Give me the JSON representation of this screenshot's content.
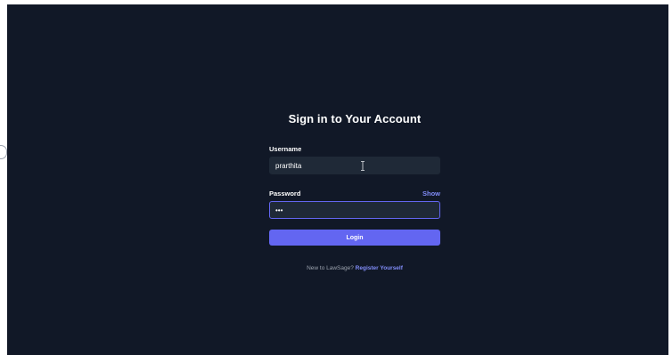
{
  "login": {
    "title": "Sign in to Your Account",
    "username_label": "Username",
    "username_value": "prarthita",
    "password_label": "Password",
    "password_value": "•••",
    "show_label": "Show",
    "login_button": "Login",
    "footer_prefix": "New to LawSage?",
    "register_link": "Register Yourself"
  },
  "colors": {
    "background": "#111827",
    "input_bg": "#1f2937",
    "accent": "#6366f1",
    "link": "#818cf8"
  },
  "icons": {
    "text_cursor": "text-cursor-icon"
  }
}
